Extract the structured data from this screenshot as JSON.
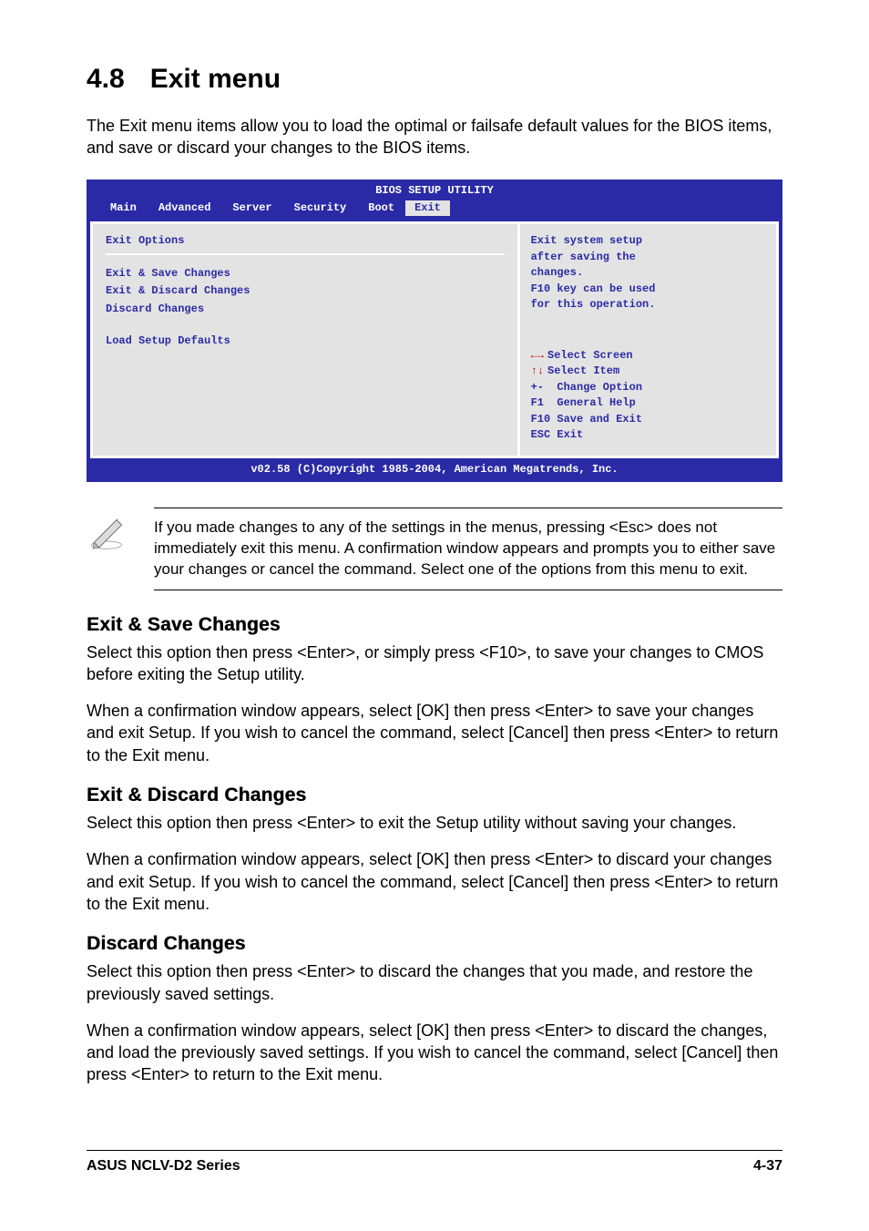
{
  "section": {
    "number": "4.8",
    "title": "Exit menu"
  },
  "intro": "The Exit menu items allow you to load the optimal or failsafe default values for the BIOS items, and save or discard your changes to the BIOS items.",
  "bios": {
    "title": "BIOS SETUP UTILITY",
    "menus": [
      "Main",
      "Advanced",
      "Server",
      "Security",
      "Boot",
      "Exit"
    ],
    "active_menu_index": 5,
    "options_title": "Exit Options",
    "options": [
      "Exit & Save Changes",
      "Exit & Discard Changes",
      "Discard Changes",
      "",
      "Load Setup Defaults"
    ],
    "help": [
      "Exit system setup",
      "after saving the",
      "changes.",
      "",
      "F10 key can be used",
      "for this operation."
    ],
    "keys": {
      "lr": "Select Screen",
      "ud": "Select Item",
      "pm": "+-  Change Option",
      "f1": "F1  General Help",
      "f10": "F10 Save and Exit",
      "esc": "ESC Exit"
    },
    "footer": "v02.58 (C)Copyright 1985-2004, American Megatrends, Inc."
  },
  "note": "If you made changes to any of the settings in the menus, pressing <Esc> does not immediately exit this menu. A confirmation window appears and prompts you to either save your changes or cancel the command. Select one of the options from this menu to exit.",
  "subsections": [
    {
      "heading": "Exit & Save Changes",
      "paras": [
        "Select this option then press <Enter>, or simply press <F10>, to save your changes to CMOS before exiting the Setup utility.",
        "When a confirmation window appears, select [OK] then press <Enter> to save your changes and exit Setup. If you wish to cancel the command, select [Cancel] then press <Enter> to return to the Exit menu."
      ]
    },
    {
      "heading": "Exit & Discard Changes",
      "paras": [
        "Select this option then press <Enter> to exit the Setup utility without saving your changes.",
        "When a confirmation window appears, select [OK] then press <Enter> to discard your changes and exit Setup. If you wish to cancel the command, select [Cancel] then press <Enter> to return to the Exit menu."
      ]
    },
    {
      "heading": "Discard Changes",
      "paras": [
        "Select this option then press <Enter> to discard the changes that you made, and restore the previously saved settings.",
        "When a confirmation window appears, select [OK] then press <Enter> to discard the changes, and load the previously saved settings. If you wish to cancel the command, select [Cancel] then press <Enter> to return to the Exit menu."
      ]
    }
  ],
  "page_footer": {
    "left": "ASUS NCLV-D2 Series",
    "right": "4-37"
  }
}
